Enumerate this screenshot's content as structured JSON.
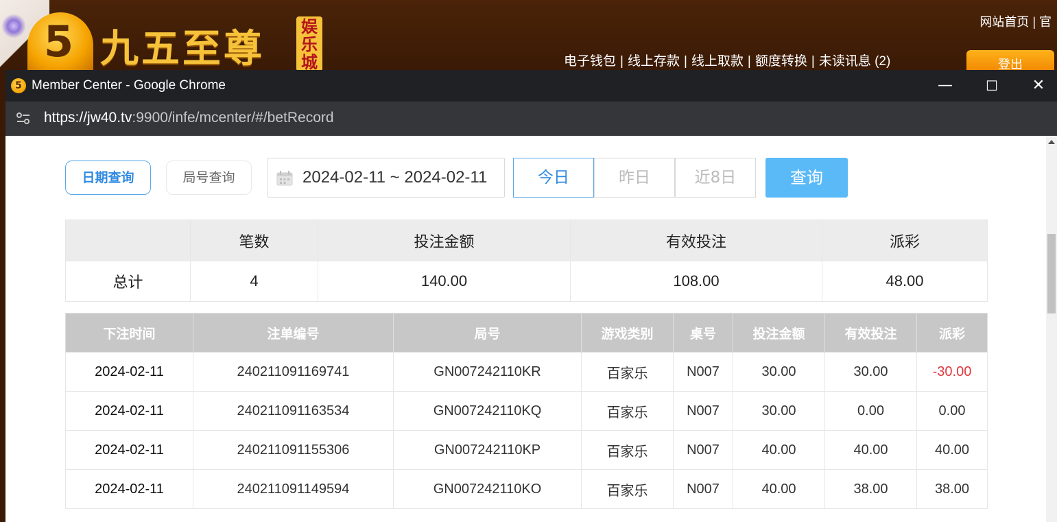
{
  "site": {
    "logo_text": "九五至尊",
    "logo_number": "5",
    "logo_badge": "娱乐城",
    "top_links": "网站首页 | 官",
    "nav": [
      "电子钱包",
      "线上存款",
      "线上取款",
      "额度转换",
      "未读讯息 (2)"
    ],
    "nav_separator": "|",
    "logout_label": "登出"
  },
  "window": {
    "title": "Member Center - Google Chrome",
    "url_host": "https://jw40.tv",
    "url_path": ":9900/infe/mcenter/#/betRecord",
    "minimize": "—",
    "maximize": "☐",
    "close": "✕"
  },
  "filters": {
    "tab_date": "日期查询",
    "tab_round": "局号查询",
    "date_range": "2024-02-11 ~ 2024-02-11",
    "today": "今日",
    "yesterday": "昨日",
    "last8": "近8日",
    "query": "查询"
  },
  "summary": {
    "headers": [
      "",
      "笔数",
      "投注金额",
      "有效投注",
      "派彩"
    ],
    "row": [
      "总计",
      "4",
      "140.00",
      "108.00",
      "48.00"
    ]
  },
  "records": {
    "headers": [
      "下注时间",
      "注单编号",
      "局号",
      "游戏类别",
      "桌号",
      "投注金额",
      "有效投注",
      "派彩"
    ],
    "rows": [
      [
        "2024-02-11",
        "240211091169741",
        "GN007242110KR",
        "百家乐",
        "N007",
        "30.00",
        "30.00",
        "-30.00"
      ],
      [
        "2024-02-11",
        "240211091163534",
        "GN007242110KQ",
        "百家乐",
        "N007",
        "30.00",
        "0.00",
        "0.00"
      ],
      [
        "2024-02-11",
        "240211091155306",
        "GN007242110KP",
        "百家乐",
        "N007",
        "40.00",
        "40.00",
        "40.00"
      ],
      [
        "2024-02-11",
        "240211091149594",
        "GN007242110KO",
        "百家乐",
        "N007",
        "40.00",
        "38.00",
        "38.00"
      ]
    ]
  },
  "colors": {
    "accent": "#2f8ae0",
    "query_button": "#5ab9f7",
    "negative": "#e2363e",
    "table_header": "#c7c7c7"
  }
}
